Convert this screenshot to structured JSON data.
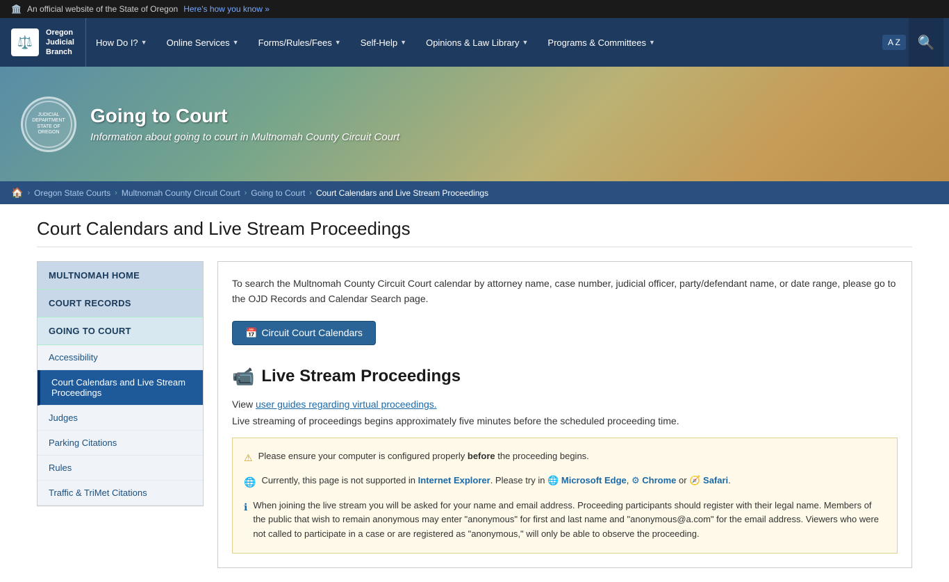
{
  "topBanner": {
    "text": "An official website of the State of Oregon",
    "linkText": "Here's how you know »"
  },
  "nav": {
    "logoText": "Oregon\nJudicial\nBranch",
    "items": [
      {
        "label": "How Do I?",
        "hasDropdown": true
      },
      {
        "label": "Online Services",
        "hasDropdown": true
      },
      {
        "label": "Forms/Rules/Fees",
        "hasDropdown": true
      },
      {
        "label": "Self-Help",
        "hasDropdown": true
      },
      {
        "label": "Opinions & Law Library",
        "hasDropdown": true
      },
      {
        "label": "Programs & Committees",
        "hasDropdown": true
      }
    ],
    "langLabel": "A Z",
    "searchAriaLabel": "Search"
  },
  "hero": {
    "title": "Going to Court",
    "subtitle": "Information about going to court in Multnomah County Circuit Court",
    "sealText": "JUDICIAL DEPARTMENT STATE OF OREGON"
  },
  "breadcrumb": {
    "home": "Home",
    "items": [
      {
        "label": "Oregon State Courts",
        "href": "#"
      },
      {
        "label": "Multnomah County Circuit Court",
        "href": "#"
      },
      {
        "label": "Going to Court",
        "href": "#"
      },
      {
        "label": "Court Calendars and Live Stream Proceedings",
        "current": true
      }
    ]
  },
  "sidebar": {
    "multnomahHeader": "MULTNOMAH HOME",
    "courtRecordsHeader": "COURT RECORDS",
    "goingToCourtHeader": "GOING TO COURT",
    "navItems": [
      {
        "label": "Accessibility",
        "active": false
      },
      {
        "label": "Court Calendars and Live Stream Proceedings",
        "active": true
      },
      {
        "label": "Judges",
        "active": false
      },
      {
        "label": "Parking Citations",
        "active": false
      },
      {
        "label": "Rules",
        "active": false
      },
      {
        "label": "Traffic & TriMet Citations",
        "active": false
      }
    ]
  },
  "content": {
    "pageTitle": "Court Calendars and Live Stream Proceedings",
    "introText": "To search the Multnomah County Circuit Court calendar by attorney name, case number, judicial officer, party/defendant name, or date range, please go to the OJD Records and Calendar Search page.",
    "calendarBtnLabel": "Circuit Court Calendars",
    "liveStreamHeading": "Live Stream Proceedings",
    "streamIntroPrefix": "View ",
    "streamIntroLink": "user guides regarding virtual proceedings.",
    "streamTiming": "Live streaming of proceedings begins approximately five minutes before the scheduled proceeding time.",
    "warningLines": [
      {
        "type": "warning",
        "text": "Please ensure your computer is configured properly before the proceeding begins.",
        "boldWord": "before"
      },
      {
        "type": "info",
        "textParts": [
          "Currently, this page is not supported in ",
          "Internet Explorer",
          ". Please try in ",
          "Microsoft Edge",
          ", ",
          "Chrome",
          " or ",
          "Safari",
          "."
        ]
      },
      {
        "type": "info",
        "text": "When joining the live stream you will be asked for your name and email address. Proceeding participants should register with their legal name. Members of the public that wish to remain anonymous may enter \"anonymous\" for first and last name and \"anonymous@a.com\" for the email address. Viewers who were not called to participate in a case or are registered as \"anonymous,\" will only be able to observe the proceeding."
      }
    ]
  }
}
